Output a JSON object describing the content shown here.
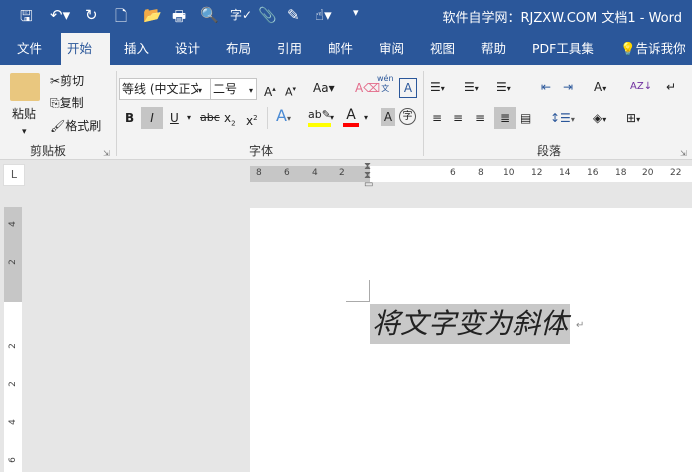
{
  "titlebar": {
    "title": "软件自学网：RJZXW.COM  文档1  -  Word",
    "quick_access": [
      "save-icon",
      "undo-icon",
      "redo-icon",
      "new-icon",
      "open-icon",
      "print-icon",
      "print-preview-icon",
      "spelling-icon",
      "attach-icon",
      "edit-icon",
      "touch-mode-icon",
      "customize-icon"
    ]
  },
  "tabs": [
    "文件",
    "开始",
    "插入",
    "设计",
    "布局",
    "引用",
    "邮件",
    "审阅",
    "视图",
    "帮助",
    "PDF工具集",
    "告诉我你想"
  ],
  "clipboard": {
    "paste": "粘贴",
    "cut": "剪切",
    "copy": "复制",
    "format_painter": "格式刷",
    "label": "剪贴板"
  },
  "font": {
    "name": "等线 (中文正文)",
    "size": "二号",
    "case": "Aa",
    "phonetic": "wén",
    "label": "字体",
    "highlight_color": "#ffff00",
    "font_color": "#ff0000"
  },
  "paragraph": {
    "label": "段落"
  },
  "ruler": {
    "left_numbers": [
      "8",
      "6",
      "4",
      "2"
    ],
    "right_numbers": [
      "6",
      "8",
      "10",
      "12",
      "14",
      "16",
      "18",
      "20",
      "22"
    ],
    "vertical_numbers": [
      "4",
      "2",
      "2",
      "2",
      "4",
      "6"
    ]
  },
  "document": {
    "text": "将文字变为斜体"
  }
}
